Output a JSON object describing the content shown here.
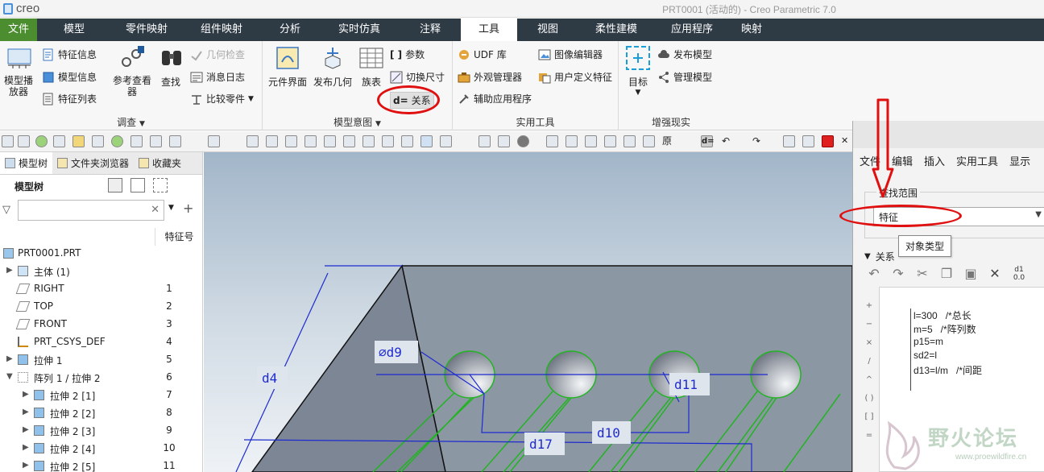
{
  "app": {
    "logo_text": "creo",
    "window_title": "PRT0001 (活动的) - Creo Parametric 7.0"
  },
  "ribbon_tabs": [
    "文件",
    "模型",
    "零件映射",
    "组件映射",
    "分析",
    "实时仿真",
    "注释",
    "工具",
    "视图",
    "柔性建模",
    "应用程序",
    "映射"
  ],
  "ribbon": {
    "investigate": {
      "title": "调查",
      "model_player": "模型播放器",
      "feature_info": "特征信息",
      "model_info": "模型信息",
      "feature_list": "特征列表",
      "reference_viewer": "参考查看器",
      "find": "查找",
      "geometry_check": "几何检查",
      "message_log": "消息日志",
      "compare_part": "比较零件"
    },
    "model_intent": {
      "title": "模型意图",
      "component_interface": "元件界面",
      "publish_geometry": "发布几何",
      "family_table": "族表",
      "parameters": "参数",
      "switch_dimensions": "切换尺寸",
      "relations": "关系"
    },
    "utilities": {
      "title": "实用工具",
      "udf_library": "UDF 库",
      "image_editor": "图像编辑器",
      "appearance_manager": "外观管理器",
      "user_defined_feature": "用户定义特征",
      "auxiliary_app": "辅助应用程序"
    },
    "ar": {
      "title": "增强现实",
      "target": "目标",
      "publish_model": "发布模型",
      "manage_model": "管理模型"
    }
  },
  "left_panel": {
    "tabs": [
      "模型树",
      "文件夹浏览器",
      "收藏夹"
    ],
    "tree_title": "模型树",
    "column_header": "特征号",
    "rows": [
      {
        "label": "PRT0001.PRT",
        "num": ""
      },
      {
        "label": "主体 (1)",
        "num": ""
      },
      {
        "label": "RIGHT",
        "num": "1"
      },
      {
        "label": "TOP",
        "num": "2"
      },
      {
        "label": "FRONT",
        "num": "3"
      },
      {
        "label": "PRT_CSYS_DEF",
        "num": "4"
      },
      {
        "label": "拉伸 1",
        "num": "5"
      },
      {
        "label": "阵列 1 / 拉伸 2",
        "num": "6"
      },
      {
        "label": "拉伸 2 [1]",
        "num": "7"
      },
      {
        "label": "拉伸 2 [2]",
        "num": "8"
      },
      {
        "label": "拉伸 2 [3]",
        "num": "9"
      },
      {
        "label": "拉伸 2 [4]",
        "num": "10"
      },
      {
        "label": "拉伸 2 [5]",
        "num": "11"
      }
    ]
  },
  "viewport": {
    "dims": {
      "d4": "d4",
      "d9": "⌀d9",
      "d11": "d11",
      "d10": "d10",
      "d17": "d17"
    }
  },
  "dialog": {
    "menu": [
      "文件",
      "编辑",
      "插入",
      "实用工具",
      "显示"
    ],
    "scope_label": "查找范围",
    "scope_value": "特征",
    "tooltip": "对象类型",
    "relations_label": "关系",
    "relations": [
      "l=300   /*总长",
      "m=5   /*阵列数",
      "p15=m",
      "sd2=l",
      "d13=l/m   /*间距"
    ]
  },
  "watermark": {
    "title": "野火论坛",
    "url": "www.proewildfire.cn"
  },
  "colors": {
    "tab_bar": "#2e3a44",
    "file_tab": "#4c8d2f",
    "annotation_red": "#e01010",
    "dimension_blue": "#1e2bd0",
    "hole_green": "#22b422"
  }
}
